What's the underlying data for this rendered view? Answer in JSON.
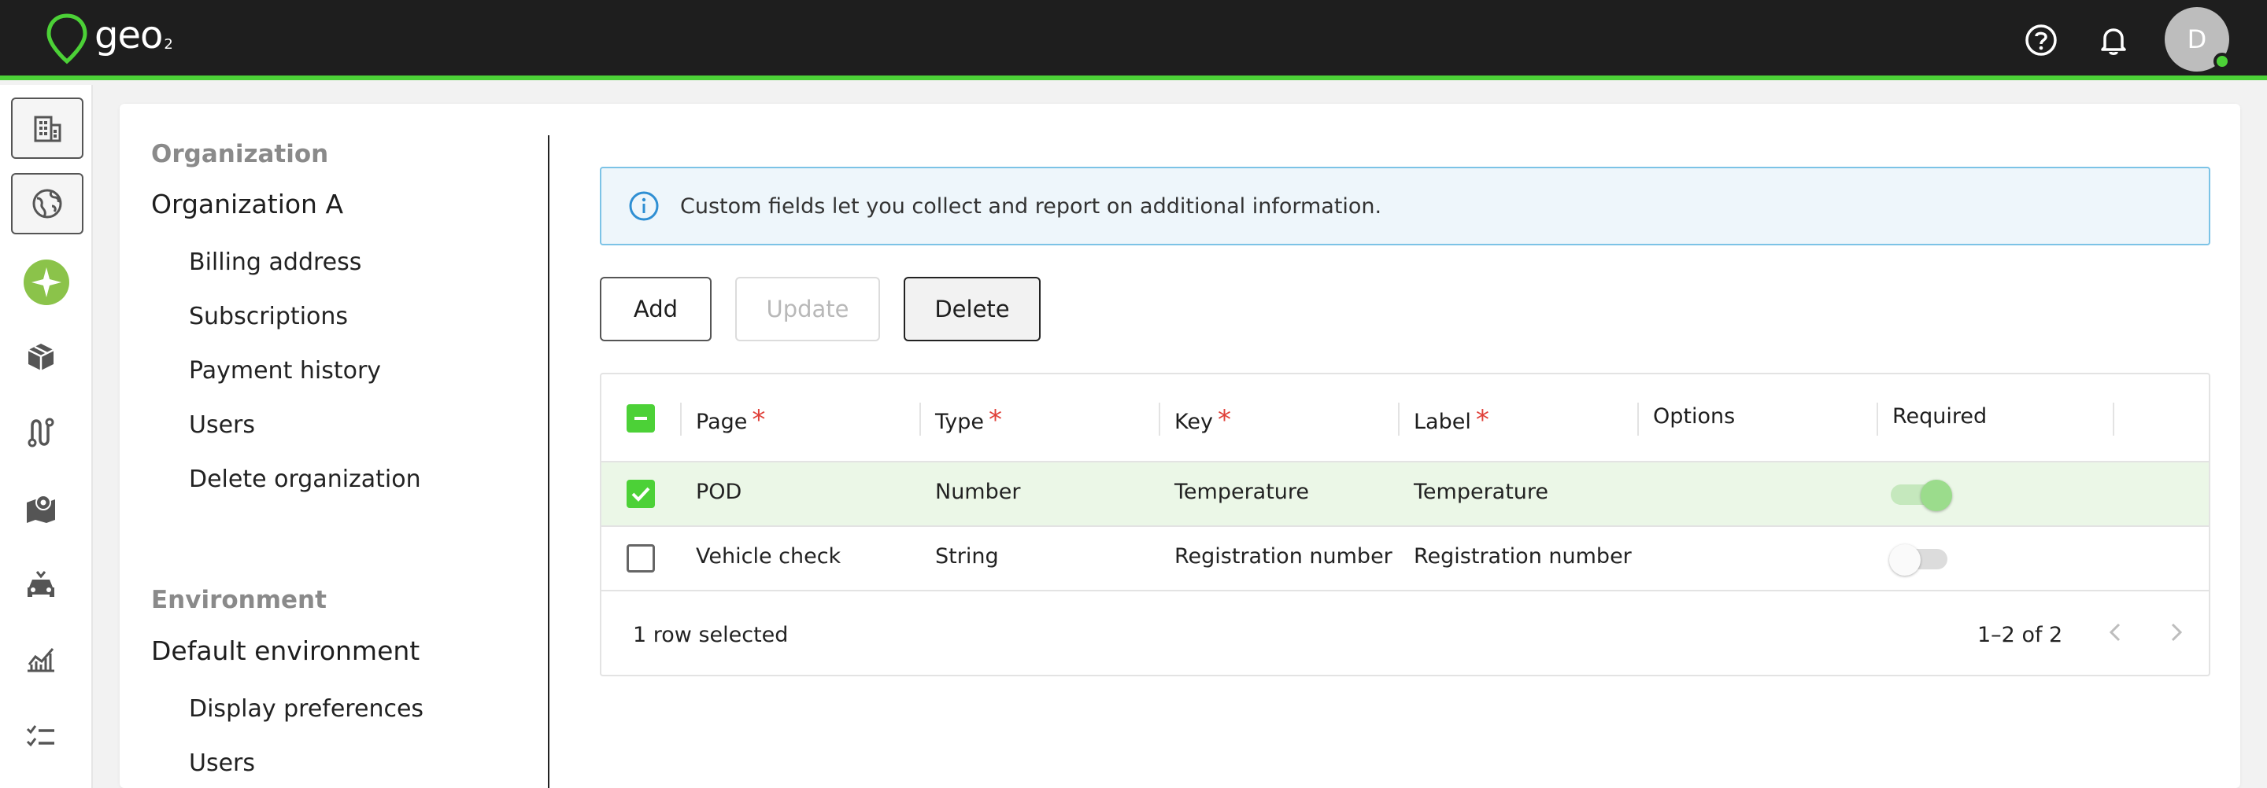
{
  "app": {
    "logo_text": "geo",
    "logo_sub": "2",
    "user_initial": "D",
    "accent": "#4cd137"
  },
  "rail": {
    "items": [
      "building-icon",
      "globe-icon",
      "sparkle-icon",
      "box-icon",
      "route-icon",
      "map-icon",
      "car-icon",
      "chart-icon",
      "checklist-icon"
    ]
  },
  "settings_nav": {
    "organization_heading": "Organization",
    "organization_name": "Organization A",
    "organization_items": [
      "Billing address",
      "Subscriptions",
      "Payment history",
      "Users",
      "Delete organization"
    ],
    "environment_heading": "Environment",
    "environment_name": "Default environment",
    "environment_items": [
      "Display preferences",
      "Users"
    ]
  },
  "banner": {
    "text": "Custom fields let you collect and report on additional information."
  },
  "toolbar": {
    "add_label": "Add",
    "update_label": "Update",
    "delete_label": "Delete"
  },
  "table": {
    "columns": [
      {
        "label": "Page",
        "required": "*"
      },
      {
        "label": "Type",
        "required": "*"
      },
      {
        "label": "Key",
        "required": "*"
      },
      {
        "label": "Label",
        "required": "*"
      },
      {
        "label": "Options",
        "required": ""
      },
      {
        "label": "Required",
        "required": ""
      }
    ],
    "rows": [
      {
        "page": "POD",
        "type": "Number",
        "key": "Temperature",
        "label": "Temperature",
        "options": "",
        "selected": true,
        "required_on": true
      },
      {
        "page": "Vehicle check",
        "type": "String",
        "key": "Registration number",
        "label": "Registration number",
        "options": "",
        "selected": false,
        "required_on": false
      }
    ],
    "selection_text": "1 row selected",
    "pagination_text": "1–2 of 2"
  }
}
